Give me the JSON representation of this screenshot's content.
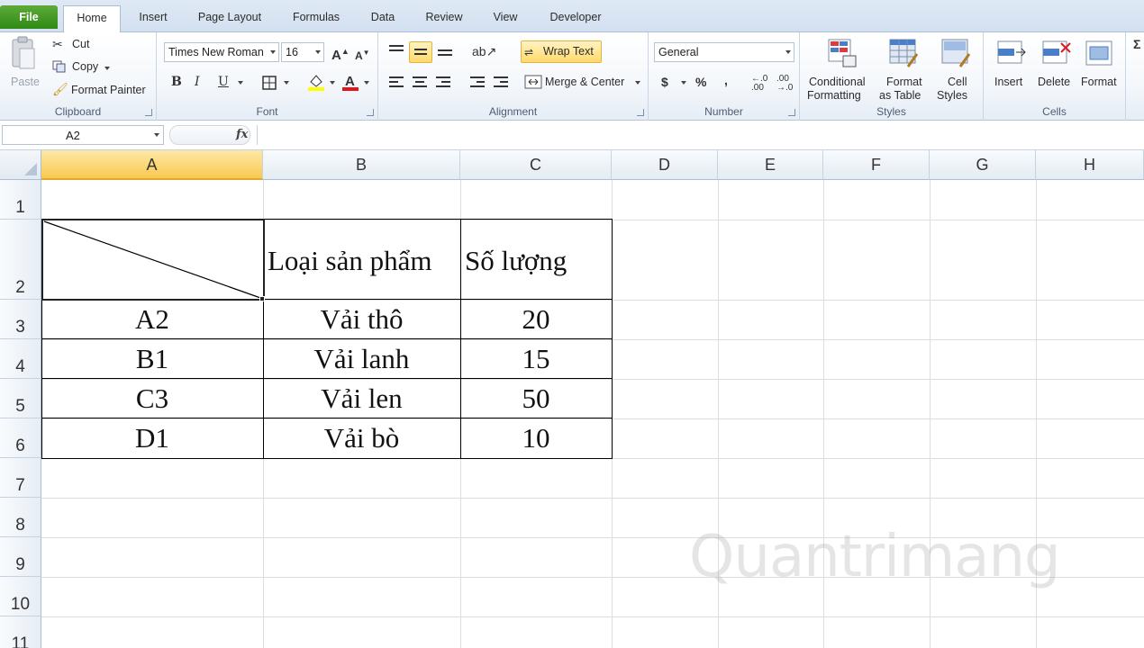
{
  "tabs": [
    "File",
    "Home",
    "Insert",
    "Page Layout",
    "Formulas",
    "Data",
    "Review",
    "View",
    "Developer"
  ],
  "clipboard": {
    "paste": "Paste",
    "cut": "Cut",
    "copy": "Copy",
    "format_painter": "Format Painter",
    "label": "Clipboard"
  },
  "font": {
    "name": "Times New Roman",
    "size": "16",
    "label": "Font"
  },
  "alignment": {
    "wrap_text": "Wrap Text",
    "merge_center": "Merge & Center",
    "label": "Alignment"
  },
  "number": {
    "format": "General",
    "label": "Number"
  },
  "styles": {
    "conditional_1": "Conditional",
    "conditional_2": "Formatting",
    "format_table_1": "Format",
    "format_table_2": "as Table",
    "cell_styles_1": "Cell",
    "cell_styles_2": "Styles",
    "label": "Styles"
  },
  "cells_group": {
    "insert": "Insert",
    "delete": "Delete",
    "format": "Format",
    "label": "Cells"
  },
  "formula_bar": {
    "name_box": "A2",
    "fx": "fx"
  },
  "columns": [
    "A",
    "B",
    "C",
    "D",
    "E",
    "F",
    "G",
    "H"
  ],
  "rows": [
    "1",
    "2",
    "3",
    "4",
    "5",
    "6",
    "7",
    "8",
    "9",
    "10",
    "11"
  ],
  "table": {
    "header_b": "Loại sản phẩm",
    "header_c": "Số lượng",
    "rows": [
      {
        "a": "A2",
        "b": "Vải thô",
        "c": "20"
      },
      {
        "a": "B1",
        "b": "Vải lanh",
        "c": "15"
      },
      {
        "a": "C3",
        "b": "Vải len",
        "c": "50"
      },
      {
        "a": "D1",
        "b": "Vải bò",
        "c": "10"
      }
    ]
  },
  "colors": {
    "accent": "#2e8a15",
    "selected_header": "#f9c94f",
    "highlight": "#ffd96a"
  },
  "watermark": "Quantrimang"
}
